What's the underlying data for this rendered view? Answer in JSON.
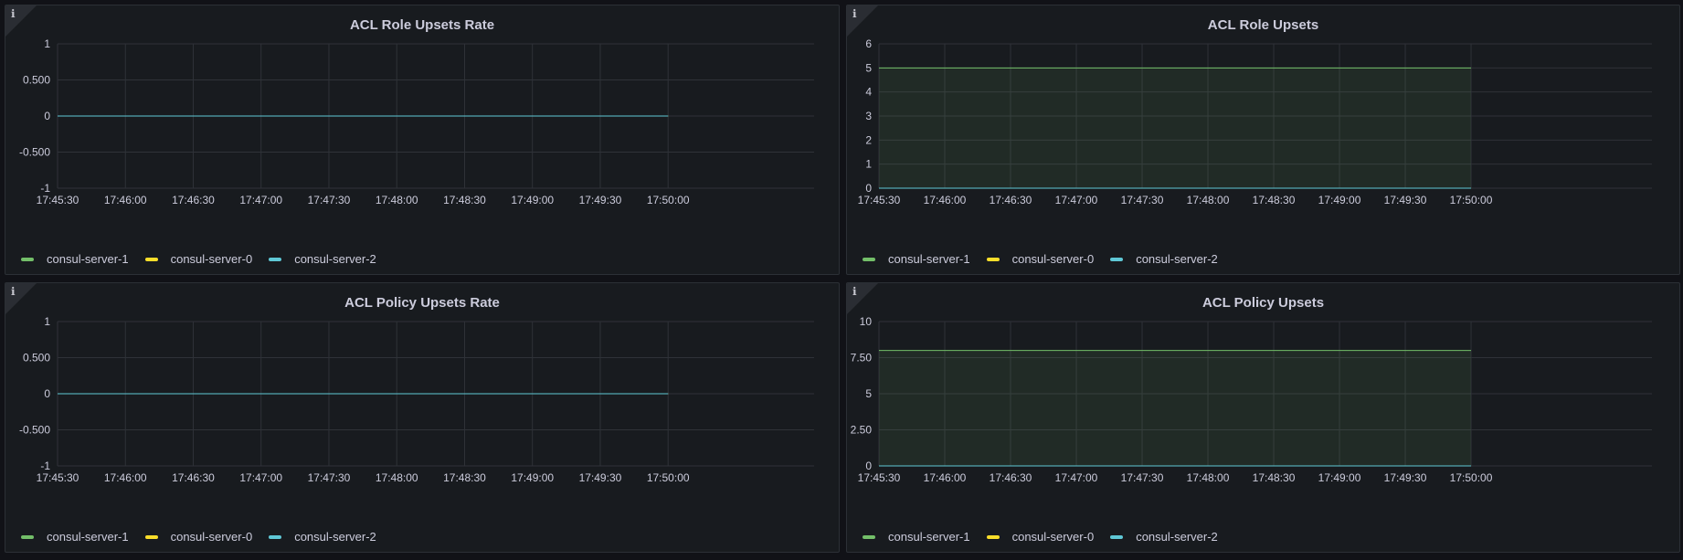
{
  "panels": [
    {
      "title": "ACL Role Upsets Rate",
      "chart_data": {
        "type": "line",
        "title": "ACL Role Upsets Rate",
        "x": [
          "17:45:30",
          "17:46:00",
          "17:46:30",
          "17:47:00",
          "17:47:30",
          "17:48:00",
          "17:48:30",
          "17:49:00",
          "17:49:30",
          "17:50:00"
        ],
        "y_ticks": [
          "1",
          "0.500",
          "0",
          "-0.500",
          "-1"
        ],
        "ylim": [
          -1,
          1
        ],
        "grid": true,
        "legend_placement": "bottom-left",
        "series": [
          {
            "name": "consul-server-1",
            "color": "#73bf69",
            "values": [
              0,
              0,
              0,
              0,
              0,
              0,
              0,
              0,
              0,
              0
            ]
          },
          {
            "name": "consul-server-0",
            "color": "#fade2a",
            "values": [
              0,
              0,
              0,
              0,
              0,
              0,
              0,
              0,
              0,
              0
            ]
          },
          {
            "name": "consul-server-2",
            "color": "#5fc8d6",
            "values": [
              0,
              0,
              0,
              0,
              0,
              0,
              0,
              0,
              0,
              0
            ]
          }
        ]
      }
    },
    {
      "title": "ACL Role Upsets",
      "chart_data": {
        "type": "area",
        "title": "ACL Role Upsets",
        "x": [
          "17:45:30",
          "17:46:00",
          "17:46:30",
          "17:47:00",
          "17:47:30",
          "17:48:00",
          "17:48:30",
          "17:49:00",
          "17:49:30",
          "17:50:00"
        ],
        "y_ticks": [
          "6",
          "5",
          "4",
          "3",
          "2",
          "1",
          "0"
        ],
        "ylim": [
          0,
          6
        ],
        "grid": true,
        "legend_placement": "bottom-left",
        "series": [
          {
            "name": "consul-server-1",
            "color": "#73bf69",
            "values": [
              5,
              5,
              5,
              5,
              5,
              5,
              5,
              5,
              5,
              5
            ]
          },
          {
            "name": "consul-server-0",
            "color": "#fade2a",
            "values": [
              0,
              0,
              0,
              0,
              0,
              0,
              0,
              0,
              0,
              0
            ]
          },
          {
            "name": "consul-server-2",
            "color": "#5fc8d6",
            "values": [
              0,
              0,
              0,
              0,
              0,
              0,
              0,
              0,
              0,
              0
            ]
          }
        ]
      }
    },
    {
      "title": "ACL Policy Upsets Rate",
      "chart_data": {
        "type": "line",
        "title": "ACL Policy Upsets Rate",
        "x": [
          "17:45:30",
          "17:46:00",
          "17:46:30",
          "17:47:00",
          "17:47:30",
          "17:48:00",
          "17:48:30",
          "17:49:00",
          "17:49:30",
          "17:50:00"
        ],
        "y_ticks": [
          "1",
          "0.500",
          "0",
          "-0.500",
          "-1"
        ],
        "ylim": [
          -1,
          1
        ],
        "grid": true,
        "legend_placement": "bottom-left",
        "series": [
          {
            "name": "consul-server-1",
            "color": "#73bf69",
            "values": [
              0,
              0,
              0,
              0,
              0,
              0,
              0,
              0,
              0,
              0
            ]
          },
          {
            "name": "consul-server-0",
            "color": "#fade2a",
            "values": [
              0,
              0,
              0,
              0,
              0,
              0,
              0,
              0,
              0,
              0
            ]
          },
          {
            "name": "consul-server-2",
            "color": "#5fc8d6",
            "values": [
              0,
              0,
              0,
              0,
              0,
              0,
              0,
              0,
              0,
              0
            ]
          }
        ]
      }
    },
    {
      "title": "ACL Policy Upsets",
      "chart_data": {
        "type": "area",
        "title": "ACL Policy Upsets",
        "x": [
          "17:45:30",
          "17:46:00",
          "17:46:30",
          "17:47:00",
          "17:47:30",
          "17:48:00",
          "17:48:30",
          "17:49:00",
          "17:49:30",
          "17:50:00"
        ],
        "y_ticks": [
          "10",
          "7.50",
          "5",
          "2.50",
          "0"
        ],
        "ylim": [
          0,
          10
        ],
        "grid": true,
        "legend_placement": "bottom-left",
        "series": [
          {
            "name": "consul-server-1",
            "color": "#73bf69",
            "values": [
              8,
              8,
              8,
              8,
              8,
              8,
              8,
              8,
              8,
              8
            ]
          },
          {
            "name": "consul-server-0",
            "color": "#fade2a",
            "values": [
              0,
              0,
              0,
              0,
              0,
              0,
              0,
              0,
              0,
              0
            ]
          },
          {
            "name": "consul-server-2",
            "color": "#5fc8d6",
            "values": [
              0,
              0,
              0,
              0,
              0,
              0,
              0,
              0,
              0,
              0
            ]
          }
        ]
      }
    }
  ],
  "info_icon": "info-icon",
  "colors": {
    "background": "#111217",
    "panel": "#181b1f",
    "grid": "#2f3238",
    "text": "#ccccdc"
  }
}
